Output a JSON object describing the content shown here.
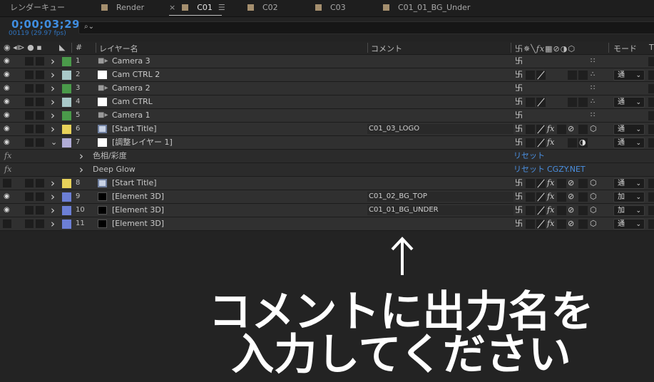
{
  "tabs": [
    {
      "label": "レンダーキュー",
      "active": false
    },
    {
      "label": "Render",
      "active": false
    },
    {
      "label": "C01",
      "active": true
    },
    {
      "label": "C02",
      "active": false
    },
    {
      "label": "C03",
      "active": false
    },
    {
      "label": "C01_01_BG_Under",
      "active": false
    }
  ],
  "tab_close": "×",
  "tab_menu": "☰",
  "timecode": "0;00;03;29",
  "fps": "00119 (29.97 fps)",
  "search": {
    "icon": "search-icon",
    "value": ""
  },
  "header": {
    "layer_name": "レイヤー名",
    "comment": "コメント",
    "mode": "モード",
    "num": "#",
    "track": "T"
  },
  "colors": {
    "accent": "#3f8de0",
    "link": "#4a8fe0",
    "panel": "#303030",
    "bg": "#232323"
  },
  "layers": [
    {
      "num": "1",
      "name": "Camera 3",
      "label_color": "#4a9a4a",
      "source": "camera",
      "comment": "",
      "mode": "",
      "expanded": false,
      "switches": "cam",
      "video": true
    },
    {
      "num": "2",
      "name": "Cam CTRL 2",
      "label_color": "#a9c9c9",
      "source": "solid-white",
      "comment": "",
      "mode": "通",
      "expanded": false,
      "switches": "null",
      "video": true
    },
    {
      "num": "3",
      "name": "Camera 2",
      "label_color": "#4a9a4a",
      "source": "camera",
      "comment": "",
      "mode": "",
      "expanded": false,
      "switches": "cam",
      "video": true
    },
    {
      "num": "4",
      "name": "Cam CTRL",
      "label_color": "#a9c9c9",
      "source": "solid-white",
      "comment": "",
      "mode": "通",
      "expanded": false,
      "switches": "null",
      "video": true
    },
    {
      "num": "5",
      "name": "Camera 1",
      "label_color": "#4a9a4a",
      "source": "camera",
      "comment": "",
      "mode": "",
      "expanded": false,
      "switches": "cam",
      "video": true
    },
    {
      "num": "6",
      "name": "[Start Title]",
      "label_color": "#e8d25a",
      "source": "comp",
      "comment": "C01_03_LOGO",
      "mode": "通",
      "expanded": false,
      "switches": "comp",
      "video": true
    },
    {
      "num": "7",
      "name": "[調整レイヤー 1]",
      "label_color": "#b0acd6",
      "source": "solid-white",
      "comment": "",
      "mode": "通",
      "expanded": true,
      "switches": "adj",
      "video": true
    },
    {
      "num": "8",
      "name": "[Start Title]",
      "label_color": "#e8d25a",
      "source": "comp",
      "comment": "",
      "mode": "通",
      "expanded": false,
      "switches": "comp",
      "video": false
    },
    {
      "num": "9",
      "name": "[Element 3D]",
      "label_color": "#6c7fd6",
      "source": "solid-black",
      "comment": "C01_02_BG_TOP",
      "mode": "加",
      "expanded": false,
      "switches": "e3d",
      "video": true
    },
    {
      "num": "10",
      "name": "[Element 3D]",
      "label_color": "#6c7fd6",
      "source": "solid-black",
      "comment": "C01_01_BG_UNDER",
      "mode": "加",
      "expanded": false,
      "switches": "e3d",
      "video": true
    },
    {
      "num": "11",
      "name": "[Element 3D]",
      "label_color": "#6c7fd6",
      "source": "solid-black",
      "comment": "",
      "mode": "通",
      "expanded": false,
      "switches": "e3d",
      "video": false
    }
  ],
  "effects": [
    {
      "fx": "fx",
      "name": "色相/彩度",
      "reset": "リセット",
      "extra": ""
    },
    {
      "fx": "fx",
      "name": "Deep Glow",
      "reset": "リセット",
      "extra": "CGZY.NET"
    }
  ],
  "annotation": {
    "arrow": "↑",
    "line1": "コメントに出力名を",
    "line2": "入力してください"
  }
}
